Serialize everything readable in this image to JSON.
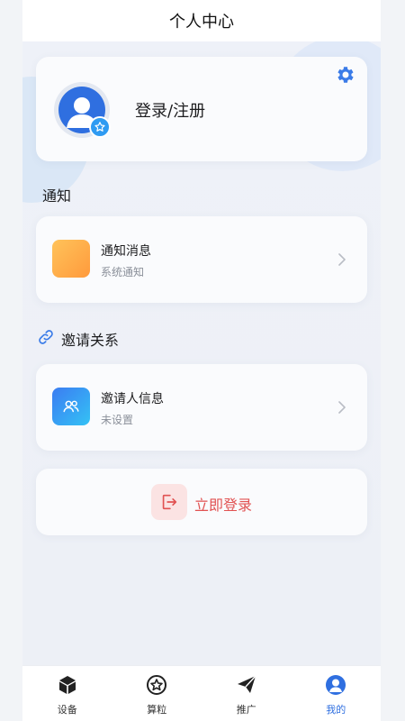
{
  "header": {
    "title": "个人中心"
  },
  "profile": {
    "login_label": "登录/注册"
  },
  "notifications": {
    "section_title": "通知",
    "item": {
      "title": "通知消息",
      "subtitle": "系统通知"
    }
  },
  "invite": {
    "section_title": "邀请关系",
    "item": {
      "title": "邀请人信息",
      "subtitle": "未设置"
    }
  },
  "login_button": {
    "label": "立即登录"
  },
  "tabbar": {
    "tabs": [
      {
        "label": "设备",
        "icon": "cube-icon"
      },
      {
        "label": "算粒",
        "icon": "star-circle-icon"
      },
      {
        "label": "推广",
        "icon": "send-icon"
      },
      {
        "label": "我的",
        "icon": "user-icon",
        "active": true
      }
    ]
  },
  "colors": {
    "accent": "#2f6fe0",
    "danger": "#e15252",
    "notify_gradient": [
      "#ffc35a",
      "#ff9a3c"
    ],
    "invite_gradient": [
      "#3b7cf2",
      "#34c2f5"
    ]
  }
}
